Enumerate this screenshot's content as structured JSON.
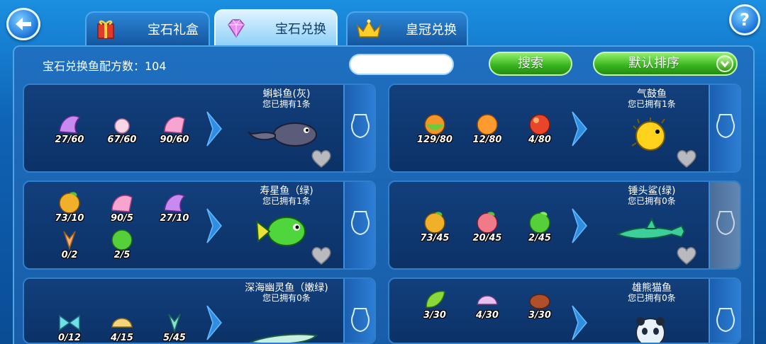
{
  "header": {
    "tabs": [
      {
        "label": "宝石礼盒",
        "icon": "gift-box-icon",
        "active": false
      },
      {
        "label": "宝石兑换",
        "icon": "diamond-icon",
        "active": true
      },
      {
        "label": "皇冠兑换",
        "icon": "crown-icon",
        "active": false
      }
    ],
    "help_label": "?"
  },
  "toolbar": {
    "recipe_count_label": "宝石兑换鱼配方数：104",
    "search_value": "",
    "search_button": "搜索",
    "sort_button": "默认排序"
  },
  "cards": [
    {
      "fish": "蝌蚪鱼(灰)",
      "owned": "您已拥有1条",
      "gems": [
        "27/60",
        "67/60",
        "90/60"
      ]
    },
    {
      "fish": "气鼓鱼",
      "owned": "您已拥有1条",
      "gems": [
        "129/80",
        "12/80",
        "4/80"
      ]
    },
    {
      "fish": "寿星鱼（绿)",
      "owned": "您已拥有1条",
      "gems": [
        "73/10",
        "90/5",
        "27/10",
        "0/2",
        "2/5"
      ]
    },
    {
      "fish": "锤头鲨(绿)",
      "owned": "您已拥有0条",
      "gems": [
        "73/45",
        "20/45",
        "2/45"
      ]
    },
    {
      "fish": "深海幽灵鱼（嫩绿)",
      "owned": "您已拥有0条",
      "gems": [
        "0/12",
        "4/15",
        "5/45"
      ]
    },
    {
      "fish": "雄熊猫鱼",
      "owned": "您已拥有0条",
      "gems": [
        "3/30",
        "4/30",
        "3/30"
      ]
    }
  ],
  "colors": {
    "accent_green": "#36b31e",
    "panel_blue": "#185da8",
    "card_blue": "#0c3267"
  }
}
